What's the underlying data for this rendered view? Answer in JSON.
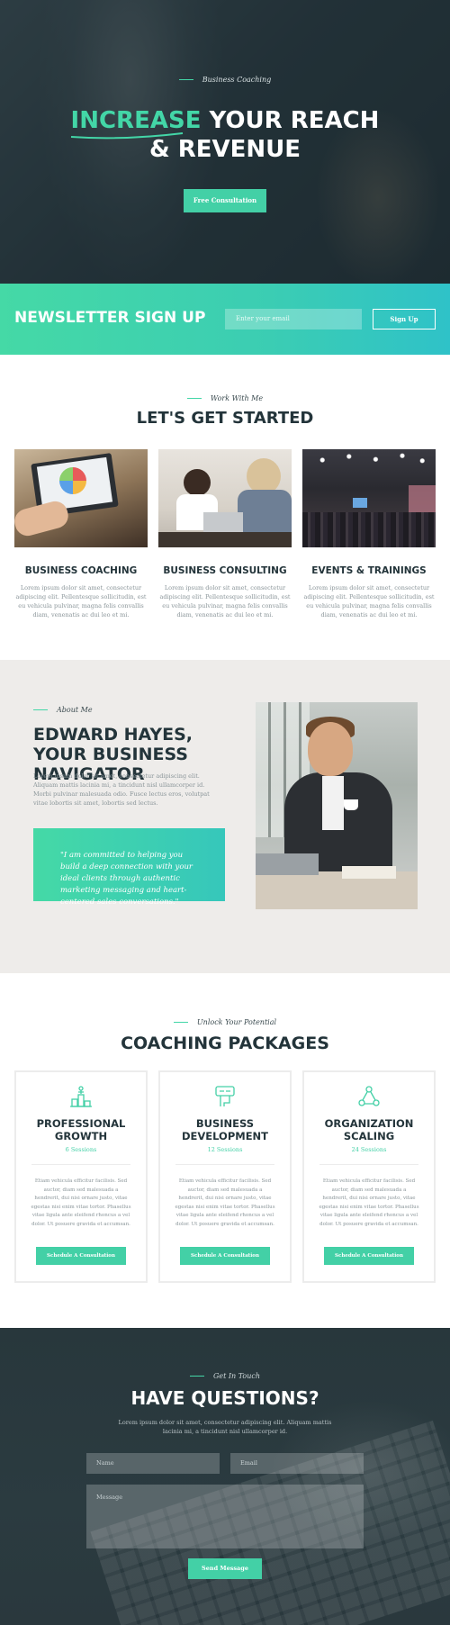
{
  "colors": {
    "accent": "#43d0a6",
    "dark": "#23343a",
    "teal_end": "#2fc2c8"
  },
  "hero": {
    "eyebrow": "Business Coaching",
    "title_accent": "INCREASE",
    "title_rest": " YOUR REACH",
    "title_line2": "& REVENUE",
    "button": "Free Consultation"
  },
  "newsletter": {
    "title": "NEWSLETTER SIGN UP",
    "email_placeholder": "Enter your email",
    "button": "Sign Up"
  },
  "started": {
    "eyebrow": "Work With Me",
    "title": "LET'S GET STARTED",
    "items": [
      {
        "title": "BUSINESS COACHING",
        "text": "Lorem ipsum dolor sit amet, consectetur adipiscing elit. Pellentesque sollicitudin, est eu vehicula pulvinar, magna felis convallis diam, venenatis ac dui leo et mi."
      },
      {
        "title": "BUSINESS CONSULTING",
        "text": "Lorem ipsum dolor sit amet, consectetur adipiscing elit. Pellentesque sollicitudin, est eu vehicula pulvinar, magna felis convallis diam, venenatis ac dui leo et mi."
      },
      {
        "title": "EVENTS & TRAININGS",
        "text": "Lorem ipsum dolor sit amet, consectetur adipiscing elit. Pellentesque sollicitudin, est eu vehicula pulvinar, magna felis convallis diam, venenatis ac dui leo et mi."
      }
    ]
  },
  "about": {
    "eyebrow": "About Me",
    "title": "EDWARD HAYES, YOUR BUSINESS NAVIGATOR",
    "text": "Lorem ipsum dolor sit amet, consectetur adipiscing elit. Aliquam mattis lacinia mi, a tincidunt nisl ullamcorper id. Morbi pulvinar malesuada odio. Fusce lectus eros, volutpat vitae lobortis sit amet, lobortis sed lectus.",
    "quote": "\"I am committed to helping you build a deep connection with your ideal clients through authentic marketing messaging and heart-centered sales conversations.\""
  },
  "packages": {
    "eyebrow": "Unlock Your Potential",
    "title": "COACHING PACKAGES",
    "items": [
      {
        "icon": "podium-icon",
        "title": "PROFESSIONAL GROWTH",
        "sessions": "6 Sessions",
        "text": "Etiam vehicula efficitur facilisis. Sed auctor, diam sed malesuada a hendrerit, dui nisi ornare justo, vitae egestas nisi enim vitae tortor. Phasellus vitae ligula ante eleifend rhoncus a vel dolor. Ut posuere gravida et accumsan.",
        "button": "Schedule A Consultation"
      },
      {
        "icon": "handshake-icon",
        "title": "BUSINESS DEVELOPMENT",
        "sessions": "12 Sessions",
        "text": "Etiam vehicula efficitur facilisis. Sed auctor, diam sed malesuada a hendrerit, dui nisi ornare justo, vitae egestas nisi enim vitae tortor. Phasellus vitae ligula ante eleifend rhoncus a vel dolor. Ut posuere gravida et accumsan.",
        "button": "Schedule A Consultation"
      },
      {
        "icon": "network-icon",
        "title": "ORGANIZATION SCALING",
        "sessions": "24 Sessions",
        "text": "Etiam vehicula efficitur facilisis. Sed auctor, diam sed malesuada a hendrerit, dui nisi ornare justo, vitae egestas nisi enim vitae tortor. Phasellus vitae ligula ante eleifend rhoncus a vel dolor. Ut posuere gravida et accumsan.",
        "button": "Schedule A Consultation"
      }
    ]
  },
  "contact": {
    "eyebrow": "Get In Touch",
    "title": "HAVE QUESTIONS?",
    "text": "Lorem ipsum dolor sit amet, consectetur adipiscing elit. Aliquam mattis lacinia mi, a tincidunt nisl ullamcorper id.",
    "name_placeholder": "Name",
    "email_placeholder": "Email",
    "message_placeholder": "Message",
    "button": "Send Message"
  }
}
